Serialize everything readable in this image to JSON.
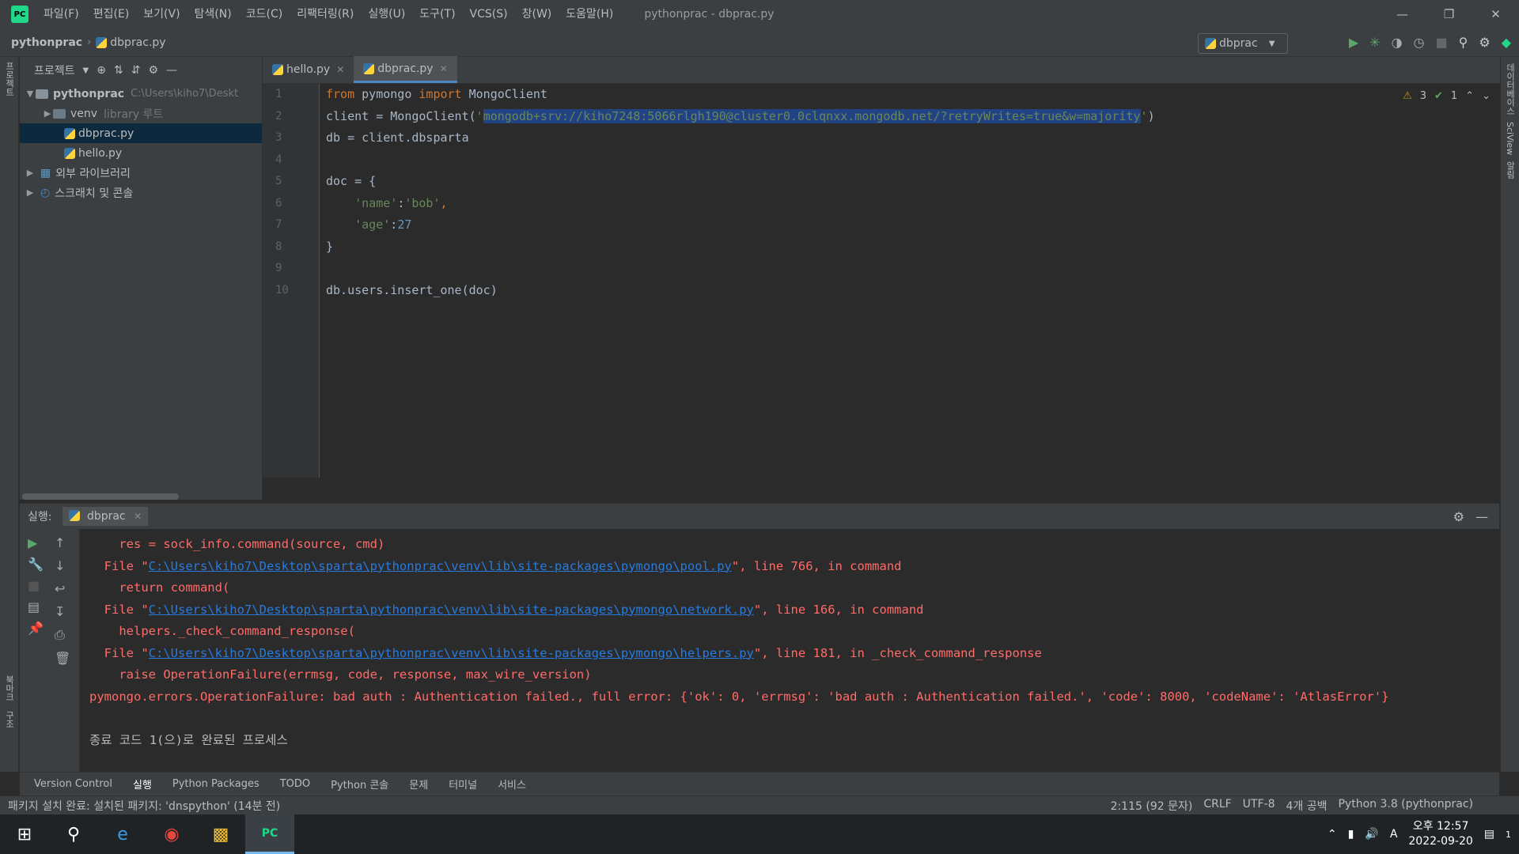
{
  "titlebar": {
    "menu": [
      "파일(F)",
      "편집(E)",
      "보기(V)",
      "탐색(N)",
      "코드(C)",
      "리팩터링(R)",
      "실행(U)",
      "도구(T)",
      "VCS(S)",
      "창(W)",
      "도움말(H)"
    ],
    "title": "pythonprac - dbprac.py"
  },
  "nav": {
    "project": "pythonprac",
    "file": "dbprac.py",
    "run_config": "dbprac"
  },
  "project": {
    "header": "프로젝트",
    "root": "pythonprac",
    "root_path": "C:\\Users\\kiho7\\Deskt",
    "venv": "venv",
    "venv_note": "library 루트",
    "files": [
      "dbprac.py",
      "hello.py"
    ],
    "ext_libs": "외부 라이브러리",
    "scratch": "스크래치 및 콘솔"
  },
  "left_strip": {
    "project": "프로젝트",
    "bookmarks": "북마크",
    "structure": "구조"
  },
  "right_strip": {
    "db": "데이터베이스",
    "sciview": "SciView",
    "notif": "알림"
  },
  "editor": {
    "tabs": [
      "hello.py",
      "dbprac.py"
    ],
    "line_numbers": [
      "1",
      "2",
      "3",
      "4",
      "5",
      "6",
      "7",
      "8",
      "9",
      "10"
    ],
    "lines": {
      "l1_kw1": "from",
      "l1_mod": " pymongo ",
      "l1_kw2": "import",
      "l1_rest": " MongoClient",
      "l2_pre": "client = MongoClient(",
      "l2_q1": "'",
      "l2_str": "mongodb+srv://kiho7248:5066rlgh190@cluster0.0clqnxx.mongodb.net/?retryWrites=true&w=majority",
      "l2_q2": "'",
      "l2_post": ")",
      "l3": "db = client.dbsparta",
      "l5": "doc = {",
      "l6_key": "    'name'",
      "l6_colon": ":",
      "l6_val": "'bob'",
      "l6_comma": ",",
      "l7_key": "    'age'",
      "l7_colon": ":",
      "l7_val": "27",
      "l8": "}",
      "l10": "db.users.insert_one(doc)"
    },
    "inspections": {
      "warnings": "3",
      "ok": "1"
    }
  },
  "run": {
    "label": "실행:",
    "tab": "dbprac",
    "console": {
      "c1": "    res = sock_info.command(source, cmd)",
      "c2_pre": "  File \"",
      "c2_link": "C:\\Users\\kiho7\\Desktop\\sparta\\pythonprac\\venv\\lib\\site-packages\\pymongo\\pool.py",
      "c2_post": "\", line 766, in command",
      "c3": "    return command(",
      "c4_pre": "  File \"",
      "c4_link": "C:\\Users\\kiho7\\Desktop\\sparta\\pythonprac\\venv\\lib\\site-packages\\pymongo\\network.py",
      "c4_post": "\", line 166, in command",
      "c5": "    helpers._check_command_response(",
      "c6_pre": "  File \"",
      "c6_link": "C:\\Users\\kiho7\\Desktop\\sparta\\pythonprac\\venv\\lib\\site-packages\\pymongo\\helpers.py",
      "c6_post": "\", line 181, in _check_command_response",
      "c7": "    raise OperationFailure(errmsg, code, response, max_wire_version)",
      "c8": "pymongo.errors.OperationFailure: bad auth : Authentication failed., full error: {'ok': 0, 'errmsg': 'bad auth : Authentication failed.', 'code': 8000, 'codeName': 'AtlasError'}",
      "c10": "종료 코드 1(으)로 완료된 프로세스"
    }
  },
  "bottom_tabs": [
    "Version Control",
    "실행",
    "Python Packages",
    "TODO",
    "Python 콘솔",
    "문제",
    "터미널",
    "서비스"
  ],
  "status": {
    "message": "패키지 설치 완료: 설치된 패키지: 'dnspython' (14분 전)",
    "position": "2:115 (92 문자)",
    "eol": "CRLF",
    "encoding": "UTF-8",
    "indent": "4개 공백",
    "interpreter": "Python 3.8 (pythonprac)"
  },
  "taskbar": {
    "ime": "A",
    "time": "오후 12:57",
    "date": "2022-09-20",
    "notif_count": "1"
  }
}
